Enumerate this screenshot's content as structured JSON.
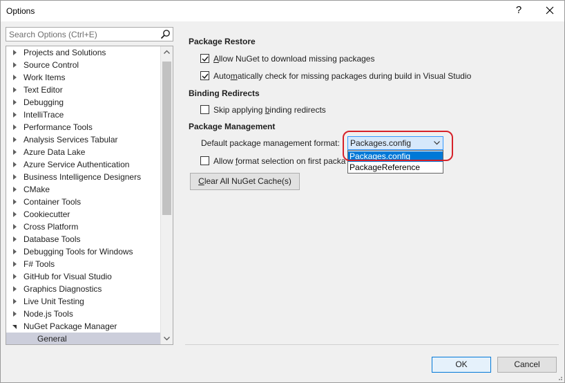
{
  "window": {
    "title": "Options",
    "help_glyph": "?",
    "close_icon": "close-icon"
  },
  "search": {
    "placeholder": "Search Options (Ctrl+E)",
    "icon": "search-icon"
  },
  "tree": {
    "items": [
      {
        "label": "Projects and Solutions",
        "state": "collapsed"
      },
      {
        "label": "Source Control",
        "state": "collapsed"
      },
      {
        "label": "Work Items",
        "state": "collapsed"
      },
      {
        "label": "Text Editor",
        "state": "collapsed"
      },
      {
        "label": "Debugging",
        "state": "collapsed"
      },
      {
        "label": "IntelliTrace",
        "state": "collapsed"
      },
      {
        "label": "Performance Tools",
        "state": "collapsed"
      },
      {
        "label": "Analysis Services Tabular",
        "state": "collapsed"
      },
      {
        "label": "Azure Data Lake",
        "state": "collapsed"
      },
      {
        "label": "Azure Service Authentication",
        "state": "collapsed"
      },
      {
        "label": "Business Intelligence Designers",
        "state": "collapsed"
      },
      {
        "label": "CMake",
        "state": "collapsed"
      },
      {
        "label": "Container Tools",
        "state": "collapsed"
      },
      {
        "label": "Cookiecutter",
        "state": "collapsed"
      },
      {
        "label": "Cross Platform",
        "state": "collapsed"
      },
      {
        "label": "Database Tools",
        "state": "collapsed"
      },
      {
        "label": "Debugging Tools for Windows",
        "state": "collapsed"
      },
      {
        "label": "F# Tools",
        "state": "collapsed"
      },
      {
        "label": "GitHub for Visual Studio",
        "state": "collapsed"
      },
      {
        "label": "Graphics Diagnostics",
        "state": "collapsed"
      },
      {
        "label": "Live Unit Testing",
        "state": "collapsed"
      },
      {
        "label": "Node.js Tools",
        "state": "collapsed"
      },
      {
        "label": "NuGet Package Manager",
        "state": "expanded"
      },
      {
        "label": "General",
        "state": "selected-child"
      }
    ]
  },
  "settings": {
    "package_restore": {
      "heading": "Package Restore",
      "allow_download": {
        "pre": "",
        "u": "A",
        "post": "llow NuGet to download missing packages",
        "checked": true
      },
      "auto_check": {
        "pre": "Auto",
        "u": "m",
        "post": "atically check for missing packages during build in Visual Studio",
        "checked": true
      }
    },
    "binding_redirects": {
      "heading": "Binding Redirects",
      "skip": {
        "pre": "Skip applying ",
        "u": "b",
        "post": "inding redirects",
        "checked": false
      }
    },
    "package_management": {
      "heading": "Package Management",
      "format_label": "Default package management format:",
      "format_value": "Packages.config",
      "format_options": [
        "Packages.config",
        "PackageReference"
      ],
      "allow_format": {
        "pre": "Allow ",
        "u": "f",
        "post": "ormat selection on first packa",
        "checked": false
      },
      "clear_cache": {
        "u": "C",
        "post": "lear All NuGet Cache(s)"
      }
    }
  },
  "footer": {
    "ok": "OK",
    "cancel": "Cancel"
  },
  "colors": {
    "selection_blue": "#0078d7",
    "highlight_red": "#d6222a",
    "tree_selected": "#cccedb"
  }
}
